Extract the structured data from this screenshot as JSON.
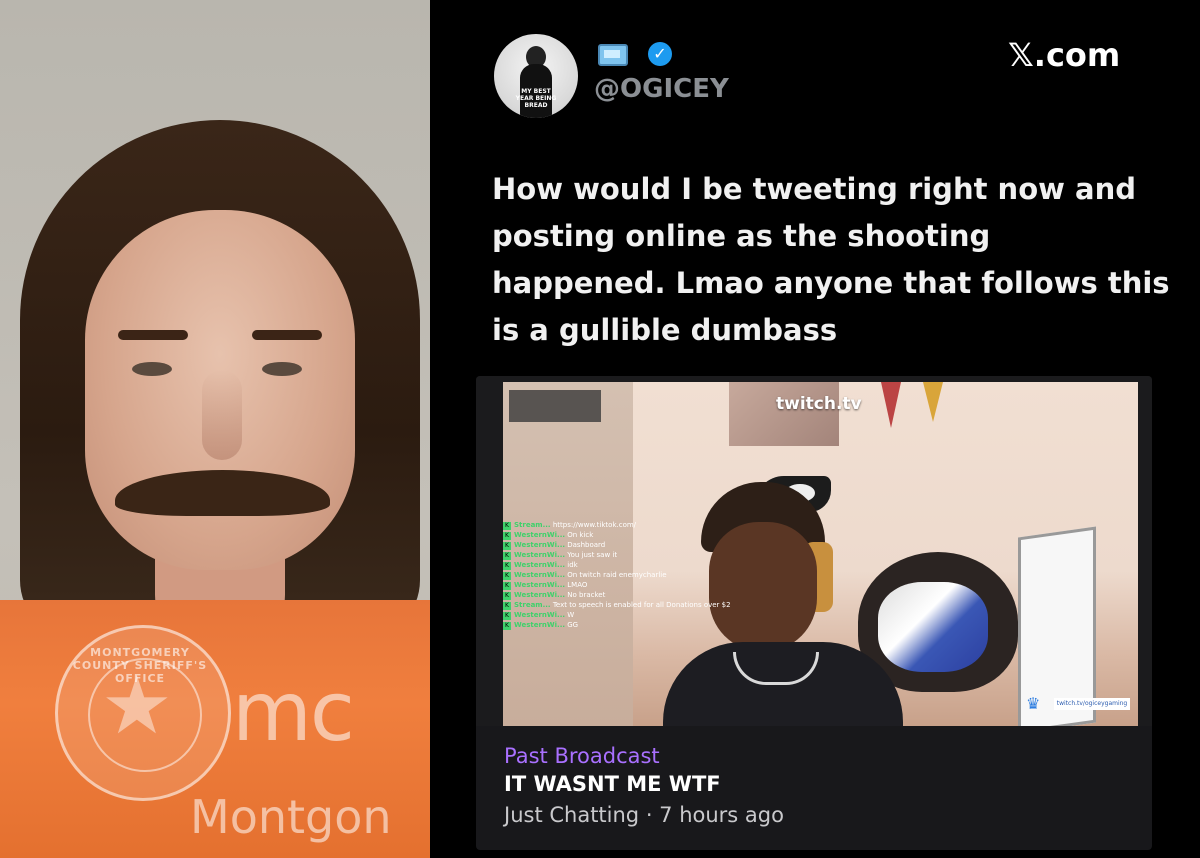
{
  "mugshot": {
    "badge_text": "MONTGOMERY COUNTY SHERIFF'S OFFICE",
    "watermark_mc": "mc",
    "watermark_montgomery": "Montgon"
  },
  "tweet": {
    "avatar_text": "MY BEST YEAR BEING BREAD",
    "handle": "@OGICEY",
    "verified": true,
    "site_x": "𝕏",
    "site_domain": ".com",
    "text": "How would I be tweeting right now and posting online as the shooting happened. Lmao anyone that follows this is a gullible dumbass"
  },
  "twitch_card": {
    "source_label": "twitch.tv",
    "overlay_tag": "twitch.tv/ogiceygaming",
    "chat": [
      {
        "user": "Stream...",
        "msg": "https://www.tiktok.com/"
      },
      {
        "user": "WesternWi...",
        "msg": "On kick"
      },
      {
        "user": "WesternWi...",
        "msg": "Dashboard"
      },
      {
        "user": "WesternWi...",
        "msg": "You just saw it"
      },
      {
        "user": "WesternWi...",
        "msg": "idk"
      },
      {
        "user": "WesternWi...",
        "msg": "On twitch raid enemycharlie"
      },
      {
        "user": "WesternWi...",
        "msg": "LMAO"
      },
      {
        "user": "WesternWi...",
        "msg": "No bracket"
      },
      {
        "user": "Stream...",
        "msg": "Text to speech is enabled for all Donations over $2"
      },
      {
        "user": "WesternWi...",
        "msg": "W"
      },
      {
        "user": "WesternWi...",
        "msg": "GG"
      }
    ],
    "status": "Past Broadcast",
    "title": "IT WASNT ME WTF",
    "category": "Just Chatting",
    "separator": " · ",
    "age": "7 hours ago",
    "accent": "#a970ff"
  }
}
